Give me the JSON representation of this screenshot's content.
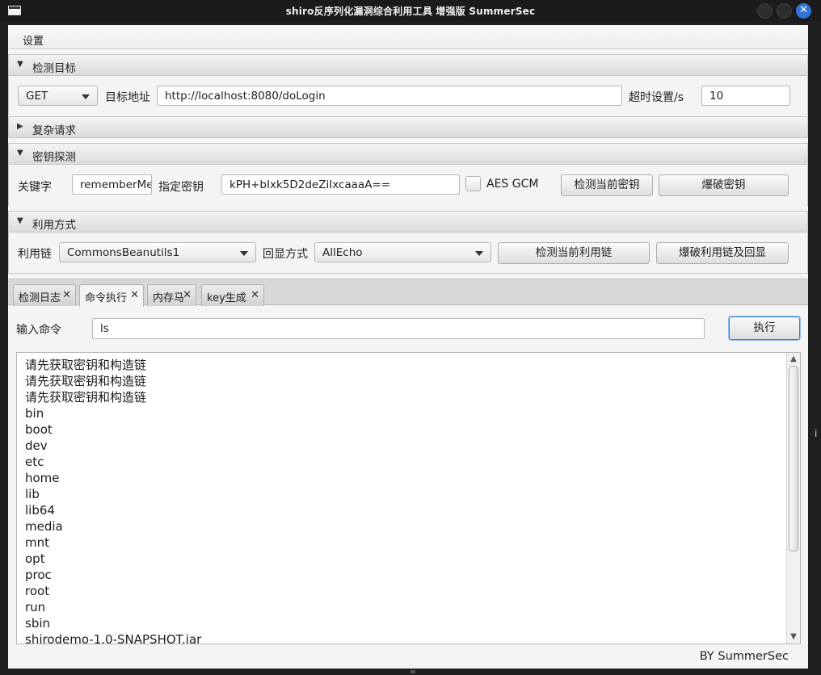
{
  "window": {
    "title": "shiro反序列化漏洞综合利用工具 增强版 SummerSec",
    "close_symbol": "✕"
  },
  "menu": {
    "settings": "设置"
  },
  "target_section": {
    "title": "检测目标",
    "method": "GET",
    "url_label": "目标地址",
    "url": "http://localhost:8080/doLogin",
    "timeout_label": "超时设置/s",
    "timeout": "10"
  },
  "complex_section": {
    "title": "复杂请求"
  },
  "key_section": {
    "title": "密钥探测",
    "keyword_label": "关键字",
    "keyword": "rememberMe",
    "key_label": "指定密钥",
    "key": "kPH+bIxk5D2deZiIxcaaaA==",
    "aes_gcm_label": "AES GCM",
    "aes_gcm_checked": false,
    "detect_key_button": "检测当前密钥",
    "crack_key_button": "爆破密钥"
  },
  "exploit_section": {
    "title": "利用方式",
    "chain_label": "利用链",
    "chain": "CommonsBeanutils1",
    "echo_label": "回显方式",
    "echo": "AllEcho",
    "detect_chain_button": "检测当前利用链",
    "crack_chain_button": "爆破利用链及回显"
  },
  "tabs": [
    {
      "label": "检测日志",
      "close": "✕"
    },
    {
      "label": "命令执行",
      "close": "✕",
      "active": true
    },
    {
      "label": "内存马",
      "close": "✕"
    },
    {
      "label": "key生成",
      "close": "✕"
    }
  ],
  "command": {
    "input_label": "输入命令",
    "input_value": "ls",
    "execute_button": "执行"
  },
  "output_lines": [
    "请先获取密钥和构造链",
    "请先获取密钥和构造链",
    "请先获取密钥和构造链",
    "bin",
    "boot",
    "dev",
    "etc",
    "home",
    "lib",
    "lib64",
    "media",
    "mnt",
    "opt",
    "proc",
    "root",
    "run",
    "sbin",
    "shirodemo-1.0-SNAPSHOT.jar"
  ],
  "footer": "BY    SummerSec",
  "edge_fragment": "i"
}
